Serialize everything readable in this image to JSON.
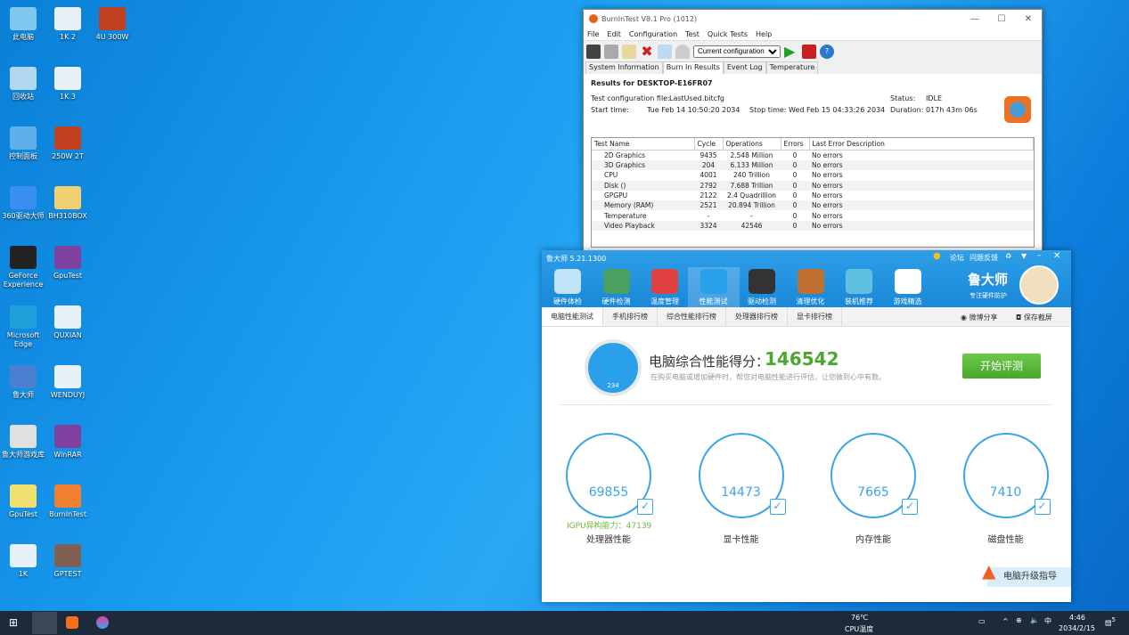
{
  "desktop": {
    "icons": [
      {
        "label": "此电脑",
        "col": 0,
        "row": 0,
        "color": "#7ec8f0"
      },
      {
        "label": "回收站",
        "col": 0,
        "row": 1,
        "color": "#b0d8f0"
      },
      {
        "label": "控制面板",
        "col": 0,
        "row": 2,
        "color": "#5fb0e8"
      },
      {
        "label": "360驱动大师",
        "col": 0,
        "row": 3,
        "color": "#3a8ef0"
      },
      {
        "label": "GeForce Experience",
        "col": 0,
        "row": 4,
        "color": "#222"
      },
      {
        "label": "Microsoft Edge",
        "col": 0,
        "row": 5,
        "color": "#1fa0d8"
      },
      {
        "label": "鲁大师",
        "col": 0,
        "row": 6,
        "color": "#4a80d0"
      },
      {
        "label": "鲁大师游戏库",
        "col": 0,
        "row": 7,
        "color": "#e0e0e0"
      },
      {
        "label": "GpuTest",
        "col": 0,
        "row": 8,
        "color": "#f0e070"
      },
      {
        "label": "1K",
        "col": 0,
        "row": 9,
        "color": "#e8f0f8"
      },
      {
        "label": "1K 2",
        "col": 1,
        "row": 0,
        "color": "#e8f0f8"
      },
      {
        "label": "1K 3",
        "col": 1,
        "row": 1,
        "color": "#e8f0f8"
      },
      {
        "label": "250W 2T",
        "col": 1,
        "row": 2,
        "color": "#c04020"
      },
      {
        "label": "BH310BOX",
        "col": 1,
        "row": 3,
        "color": "#f0d070"
      },
      {
        "label": "GpuTest",
        "col": 1,
        "row": 4,
        "color": "#8040a0"
      },
      {
        "label": "QUXIAN",
        "col": 1,
        "row": 5,
        "color": "#e8f0f8"
      },
      {
        "label": "WENDUYJ",
        "col": 1,
        "row": 6,
        "color": "#e8f0f8"
      },
      {
        "label": "WinRAR",
        "col": 1,
        "row": 7,
        "color": "#8040a0"
      },
      {
        "label": "BurnInTest",
        "col": 1,
        "row": 8,
        "color": "#f08030"
      },
      {
        "label": "GPTEST",
        "col": 1,
        "row": 9,
        "color": "#806050"
      },
      {
        "label": "4U 300W",
        "col": 2,
        "row": 0,
        "color": "#c04020"
      }
    ]
  },
  "burnintest": {
    "title": "BurnInTest V8.1 Pro (1012)",
    "menu": [
      "File",
      "Edit",
      "Configuration",
      "Test",
      "Quick Tests",
      "Help"
    ],
    "config_select": "Current configuration",
    "tabs": [
      "System Information",
      "Burn In Results",
      "Event Log",
      "Temperature"
    ],
    "results_header": "Results for DESKTOP-E16FR07",
    "config_file_label": "Test configuration file:",
    "config_file": "LastUsed.bitcfg",
    "start_label": "Start time:",
    "start": "Tue Feb 14 10:50:20 2034",
    "stop_label": "Stop time:",
    "stop": "Wed Feb 15 04:33:26 2034",
    "status_label": "Status:",
    "status": "IDLE",
    "duration_label": "Duration:",
    "duration": "017h 43m 06s",
    "columns": [
      "Test Name",
      "Cycle",
      "Operations",
      "Errors",
      "Last Error Description"
    ],
    "rows": [
      [
        "2D Graphics",
        "9435",
        "2.548 Million",
        "0",
        "No errors"
      ],
      [
        "3D Graphics",
        "204",
        "6.133 Million",
        "0",
        "No errors"
      ],
      [
        "CPU",
        "4001",
        "240 Trillion",
        "0",
        "No errors"
      ],
      [
        "Disk ()",
        "2792",
        "7.688 Trillion",
        "0",
        "No errors"
      ],
      [
        "GPGPU",
        "2122",
        "2.4 Quadrillion",
        "0",
        "No errors"
      ],
      [
        "Memory (RAM)",
        "2521",
        "20.894 Trillion",
        "0",
        "No errors"
      ],
      [
        "Temperature",
        "-",
        "-",
        "0",
        "No errors"
      ],
      [
        "Video Playback",
        "3324",
        "42546",
        "0",
        "No errors"
      ]
    ]
  },
  "ludashi": {
    "title": "鲁大师 5.21.1300",
    "top_links": [
      "论坛",
      "问题反馈"
    ],
    "brand": "鲁大师",
    "slogan": "专注硬件防护",
    "nav": [
      "硬件体检",
      "硬件检测",
      "温度管理",
      "性能测试",
      "驱动检测",
      "清理优化",
      "装机推荐",
      "游戏精选"
    ],
    "active_nav": 3,
    "subtabs": [
      "电脑性能测试",
      "手机排行榜",
      "综合性能排行榜",
      "处理器排行榜",
      "显卡排行榜"
    ],
    "share": "微博分享",
    "save": "保存截屏",
    "score_label": "电脑综合性能得分：",
    "score": "146542",
    "desc": "在购买电脑或增加硬件时，帮您对电脑性能进行评估，让您做到心中有数。",
    "start_button": "开始评测",
    "gauge_text": "234",
    "scores": [
      {
        "value": "69855",
        "label": "处理器性能"
      },
      {
        "value": "14473",
        "label": "显卡性能"
      },
      {
        "value": "7665",
        "label": "内存性能"
      },
      {
        "value": "7410",
        "label": "磁盘性能"
      }
    ],
    "igpu": "IGPU异构能力：47139",
    "upgrade": "电脑升级指导",
    "accent": "#39a4ea",
    "score_color": "#4aa832"
  },
  "taskbar": {
    "temp": "76℃",
    "temp_label": "CPU温度",
    "ime": "中",
    "time": "4:46",
    "date": "2034/2/15",
    "notifications": "5"
  }
}
